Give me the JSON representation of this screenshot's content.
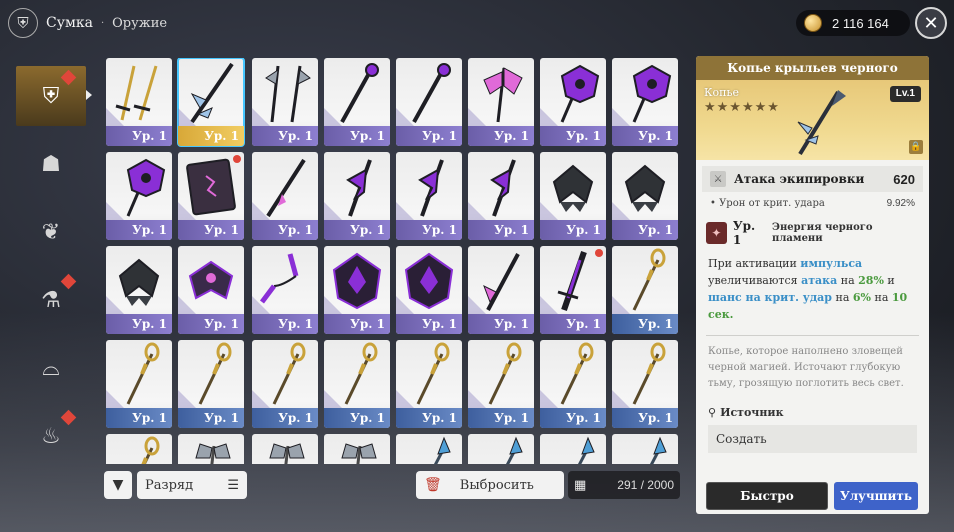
{
  "header": {
    "title": "Сумка",
    "separator": "·",
    "section": "Оружие",
    "gold": "2 116 164",
    "close_icon": "close-icon"
  },
  "categories": [
    {
      "id": "weapon",
      "icon": "shield-swords-icon",
      "active": true,
      "badge": true
    },
    {
      "id": "armor",
      "icon": "armor-icon",
      "active": false,
      "badge": false
    },
    {
      "id": "accessory",
      "icon": "necklace-icon",
      "active": false,
      "badge": false
    },
    {
      "id": "potion",
      "icon": "potion-icon",
      "active": false,
      "badge": true
    },
    {
      "id": "food",
      "icon": "cloche-icon",
      "active": false,
      "badge": false
    },
    {
      "id": "materials",
      "icon": "bag-icon",
      "active": false,
      "badge": true
    }
  ],
  "slot_level_label": "Ур. 1",
  "grid": {
    "rows": [
      [
        "twin-gold-swords",
        "selected-spear",
        "twin-silver-axes",
        "dark-staff",
        "dark-staff",
        "purple-axe",
        "purple-wing-axe",
        "purple-wing-axe"
      ],
      [
        "purple-wing-axe",
        "grimoire",
        "dark-spear",
        "dark-scythe",
        "dark-scythe",
        "dark-scythe",
        "dark-wings",
        "dark-wings"
      ],
      [
        "dark-wings",
        "purple-wings",
        "purple-nunchaku",
        "purple-demon-wings",
        "purple-demon-wings",
        "purple-halberd",
        "purple-greatsword",
        "gold-staff"
      ],
      [
        "gold-staff",
        "gold-staff",
        "gold-staff",
        "gold-staff",
        "gold-staff",
        "gold-staff",
        "gold-staff",
        "gold-staff"
      ],
      [
        "gold-staff",
        "silver-axe",
        "silver-axe",
        "silver-axe",
        "blue-spear",
        "blue-spear",
        "blue-spear",
        "blue-spear"
      ]
    ]
  },
  "toolbar": {
    "sort_label": "Разряд",
    "discard_label": "Выбросить",
    "capacity": "291 / 2000"
  },
  "detail": {
    "title": "Копье крыльев черного пламени",
    "type": "Копье",
    "stars": "★★★★★★",
    "level": "Lv.1",
    "main_stat_label": "Атака экипировки",
    "main_stat_value": "620",
    "sub_stat_label": "Урон от крит. удара",
    "sub_stat_value": "9.92%",
    "skill_level": "Ур. 1",
    "skill_name": "Энергия черного пламени",
    "desc_1": "При активации ",
    "desc_impulse": "импульса",
    "desc_2": " увеличиваются ",
    "desc_attack": "атака",
    "desc_3": " на ",
    "desc_28": "28%",
    "desc_4": " и ",
    "desc_crit": "шанс на крит. удар",
    "desc_5": " на ",
    "desc_6": "6%",
    "desc_6b": " на ",
    "desc_10": "10",
    "desc_sec": "сек.",
    "lore": "Копье, которое наполнено зловещей черной магией. Источают глубокую тьму, грозящую поглотить весь свет.",
    "source_label": "Источник",
    "source_value": "Создать",
    "quick_equip": "Быстро снарядить",
    "upgrade": "Улучшить"
  },
  "colors": {
    "accent_gold": "#8e7338",
    "upgrade_blue": "#3e63c9",
    "selected_outline": "#47c7ff",
    "level_bar_purple": "#8d7fd0",
    "level_bar_gold": "#f1cd62",
    "level_bar_blue": "#6a8bc6"
  }
}
